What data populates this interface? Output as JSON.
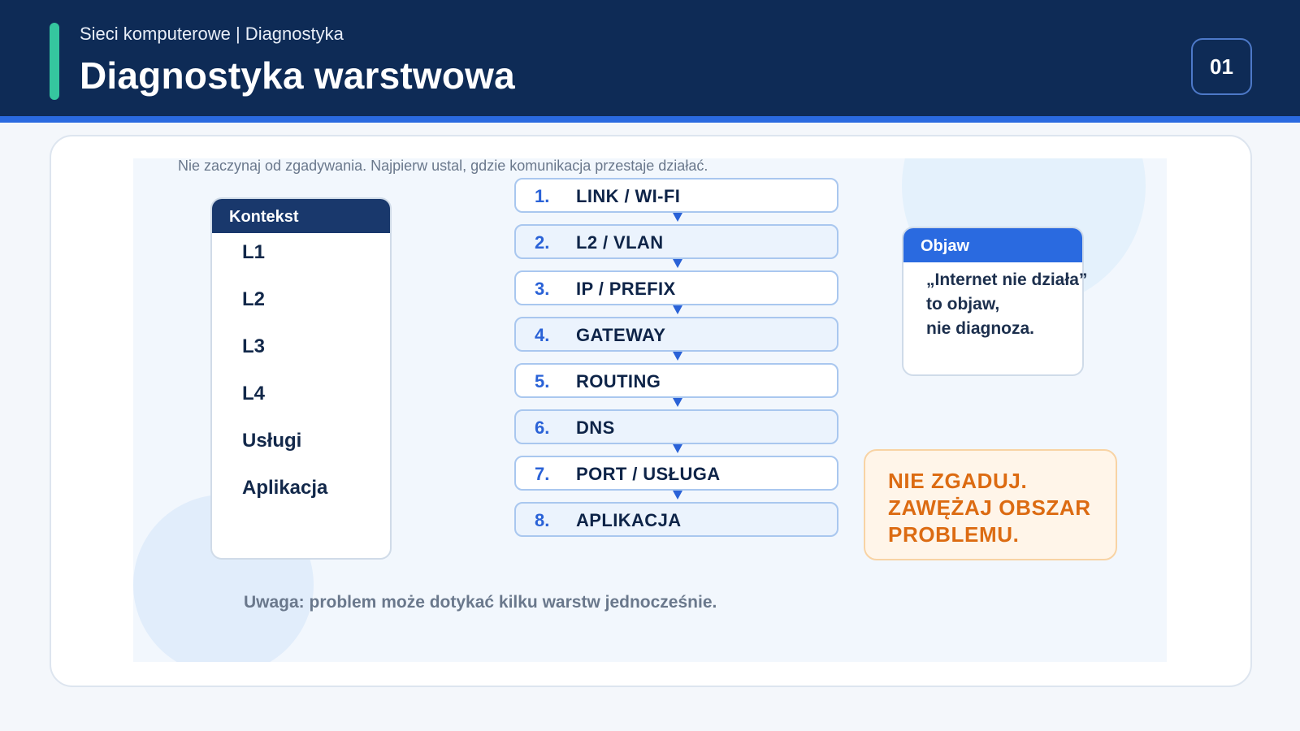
{
  "header": {
    "breadcrumb": "Sieci komputerowe | Diagnostyka",
    "title": "Diagnostyka warstwowa",
    "slide_number": "01"
  },
  "intro": "Nie zaczynaj od zgadywania. Najpierw ustal, gdzie komunikacja przestaje działać.",
  "context": {
    "heading": "Kontekst",
    "items": [
      "L1",
      "L2",
      "L3",
      "L4",
      "Usługi",
      "Aplikacja"
    ]
  },
  "steps": [
    {
      "num": "1.",
      "label": "LINK / WI-FI"
    },
    {
      "num": "2.",
      "label": "L2 / VLAN"
    },
    {
      "num": "3.",
      "label": "IP / PREFIX"
    },
    {
      "num": "4.",
      "label": "GATEWAY"
    },
    {
      "num": "5.",
      "label": "ROUTING"
    },
    {
      "num": "6.",
      "label": "DNS"
    },
    {
      "num": "7.",
      "label": "PORT / USŁUGA"
    },
    {
      "num": "8.",
      "label": "APLIKACJA"
    }
  ],
  "symptom": {
    "heading": "Objaw",
    "lines": [
      "„Internet nie działa”",
      "to objaw,",
      "nie diagnoza."
    ]
  },
  "warning": {
    "lines": [
      "NIE ZGADUJ.",
      "ZAWĘŻAJ OBSZAR",
      "PROBLEMU."
    ]
  },
  "note": "Uwaga: problem może dotykać kilku warstw jednocześnie.",
  "colors": {
    "header_bg": "#0e2b56",
    "accent_green": "#35c69f",
    "accent_blue": "#2a6ae0",
    "warning_orange": "#dc6b12"
  }
}
